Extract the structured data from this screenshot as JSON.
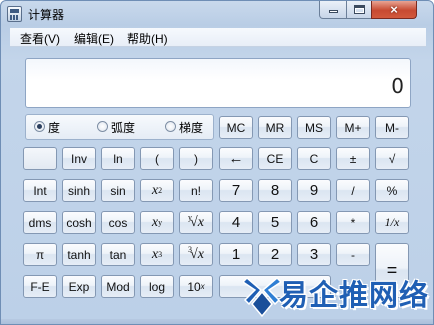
{
  "window": {
    "title": "计算器"
  },
  "menu": [
    "查看(V)",
    "编辑(E)",
    "帮助(H)"
  ],
  "display": {
    "value": "0"
  },
  "angle_modes": [
    {
      "label": "度",
      "checked": true
    },
    {
      "label": "弧度",
      "checked": false
    },
    {
      "label": "梯度",
      "checked": false
    }
  ],
  "memory_keys": [
    "MC",
    "MR",
    "MS",
    "M+",
    "M-"
  ],
  "keys": {
    "inv": "Inv",
    "ln": "ln",
    "lparen": "(",
    "rparen": ")",
    "backspace": "←",
    "ce": "CE",
    "c": "C",
    "plusminus": "±",
    "sqrt": "√",
    "int": "Int",
    "sinh": "sinh",
    "sin": "sin",
    "x2": "x",
    "x2_exp": "2",
    "nfact": "n!",
    "seven": "7",
    "eight": "8",
    "nine": "9",
    "divide": "/",
    "percent": "%",
    "dms": "dms",
    "cosh": "cosh",
    "cos": "cos",
    "xy": "x",
    "xy_exp": "y",
    "yroot_idx": "y",
    "yroot": "√x",
    "four": "4",
    "five": "5",
    "six": "6",
    "multiply": "*",
    "reciprocal": "1/x",
    "pi": "π",
    "tanh": "tanh",
    "tan": "tan",
    "x3": "x",
    "x3_exp": "3",
    "cuberoot_idx": "3",
    "cuberoot": "√x",
    "one": "1",
    "two": "2",
    "three": "3",
    "minus": "-",
    "equals": "=",
    "fe": "F-E",
    "exp": "Exp",
    "mod": "Mod",
    "log": "log",
    "tenx": "10",
    "tenx_exp": "x"
  },
  "watermark": {
    "text": "易企推网络"
  },
  "colors": {
    "accent": "#1f5fb4",
    "close": "#c74a31",
    "frame": "#bcd0e8"
  }
}
